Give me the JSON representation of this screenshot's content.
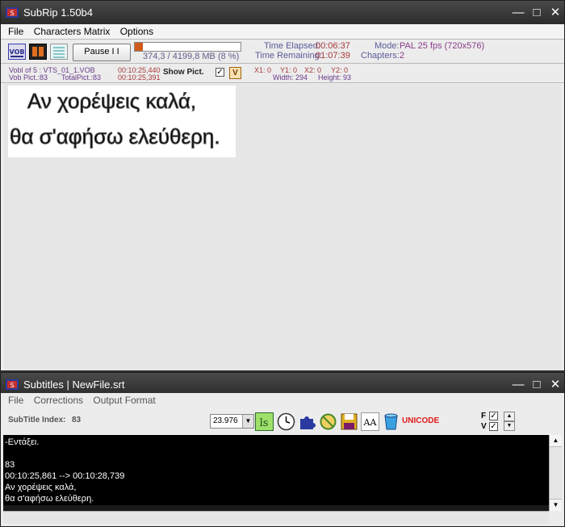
{
  "top_window": {
    "title": "SubRip 1.50b4",
    "menu": [
      "File",
      "Characters Matrix",
      "Options"
    ],
    "toolbar": {
      "vob_icon": "vob-icon",
      "pause_label": "Pause  I I",
      "progress_text": "374,3 / 4199,8 MB (8 %)",
      "progress_fraction": 0.08,
      "time_elapsed_label": "Time Elapsed:",
      "time_elapsed_value": "00:06:37",
      "time_remaining_label": "Time Remaining:",
      "time_remaining_value": "01:07:39",
      "mode_label": "Mode:",
      "mode_value": "PAL 25 fps (720x576)",
      "chapters_label": "Chapters:",
      "chapters_value": "2"
    },
    "infobar": {
      "vobl": "Vobl    of 5 : VTS_01_1.VOB",
      "vob_pict": "Vob Pict.:83",
      "total_pict": "TotalPict.:83",
      "time1": "00:10:25,440",
      "time2": "00:10:25,391",
      "show_pict": "Show Pict.",
      "show_pict_checked": "✓",
      "v_button": "V",
      "x1": "X1: 0",
      "y1": "Y1: 0",
      "x2": "X2: 0",
      "y2": "Y2: 0",
      "width": "Width: 294",
      "height": "Height: 93"
    },
    "subtitle_image_lines": [
      "Αν χορέψεις καλά,",
      "θα σ'αφήσω ελεύθερη."
    ]
  },
  "bottom_window": {
    "title": "Subtitles | NewFile.srt",
    "menu": [
      "File",
      "Corrections",
      "Output Format"
    ],
    "toolbar": {
      "index_label": "SubTitle Index:",
      "index_value": "83",
      "fps_value": "23.976",
      "unicode_label": "UNICODE",
      "f_label": "F",
      "v_label": "V"
    },
    "text_lines": [
      "-Εντάξει.",
      "",
      "83",
      "00:10:25,861 --> 00:10:28,739",
      "Αν χορέψεις καλά,",
      "θα σ'αφήσω ελεύθερη."
    ]
  },
  "colors": {
    "title_bg": "#2e2e2e",
    "accent_red": "#a83a3a",
    "accent_purple": "#8a3a8a",
    "unicode_red": "#e01818"
  }
}
